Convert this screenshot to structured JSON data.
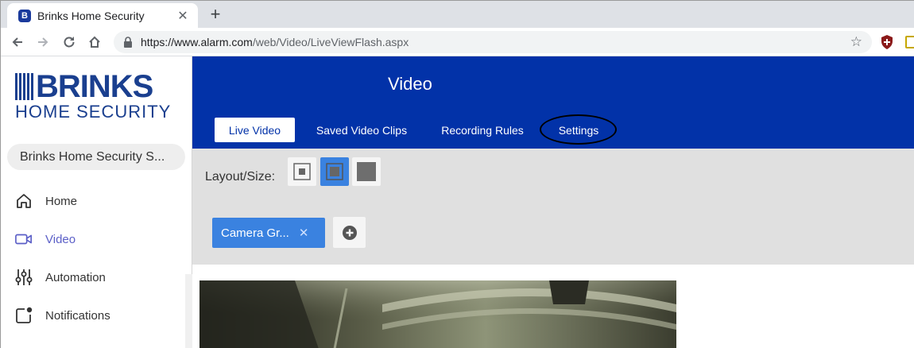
{
  "browser": {
    "tab_title": "Brinks Home Security",
    "tab_favicon_letter": "B",
    "url_host": "https://www.alarm.com",
    "url_path": "/web/Video/LiveViewFlash.aspx"
  },
  "sidebar": {
    "logo_word": "BRINKS",
    "logo_sub": "HOME SECURITY",
    "account": "Brinks Home Security S...",
    "items": [
      {
        "label": "Home",
        "icon": "home-icon"
      },
      {
        "label": "Video",
        "icon": "video-camera-icon",
        "active": true
      },
      {
        "label": "Automation",
        "icon": "sliders-icon"
      },
      {
        "label": "Notifications",
        "icon": "notifications-icon"
      }
    ]
  },
  "header": {
    "title": "Video",
    "tabs": [
      {
        "label": "Live Video",
        "active": true
      },
      {
        "label": "Saved Video Clips"
      },
      {
        "label": "Recording Rules"
      },
      {
        "label": "Settings",
        "circled": true
      }
    ]
  },
  "content": {
    "layout_label": "Layout/Size:",
    "layout_selected_index": 1,
    "camera_group": "Camera Gr...",
    "chip_close": "✕"
  },
  "colors": {
    "brand_blue": "#0232a8",
    "logo_blue": "#1a3f8f",
    "accent_blue": "#3a82e0",
    "active_nav": "#5b5fc7"
  }
}
